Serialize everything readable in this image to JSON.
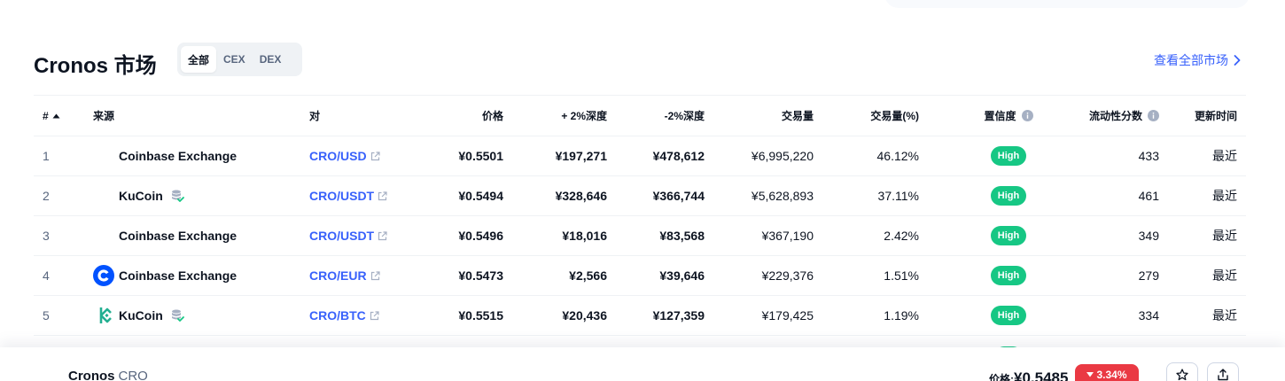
{
  "header": {
    "title": "Cronos 市场",
    "tabs": [
      {
        "label": "全部",
        "active": true
      },
      {
        "label": "CEX",
        "active": false
      },
      {
        "label": "DEX",
        "active": false
      }
    ],
    "view_all": "查看全部市场"
  },
  "table": {
    "columns": {
      "num": "#",
      "source": "来源",
      "pair": "对",
      "price": "价格",
      "depth_plus": "+ 2%深度",
      "depth_minus": "-2%深度",
      "volume": "交易量",
      "volume_pct": "交易量(%)",
      "confidence": "置信度",
      "liquidity": "流动性分数",
      "updated": "更新时间"
    },
    "rows": [
      {
        "num": "1",
        "source": "Coinbase Exchange",
        "logo": "none",
        "db_icon": false,
        "pair": "CRO/USD",
        "price": "¥0.5501",
        "depth_plus": "¥197,271",
        "depth_minus": "¥478,612",
        "volume": "¥6,995,220",
        "volume_pct": "46.12%",
        "confidence": "High",
        "liquidity": "433",
        "updated": "最近"
      },
      {
        "num": "2",
        "source": "KuCoin",
        "logo": "none",
        "db_icon": true,
        "pair": "CRO/USDT",
        "price": "¥0.5494",
        "depth_plus": "¥328,646",
        "depth_minus": "¥366,744",
        "volume": "¥5,628,893",
        "volume_pct": "37.11%",
        "confidence": "High",
        "liquidity": "461",
        "updated": "最近"
      },
      {
        "num": "3",
        "source": "Coinbase Exchange",
        "logo": "none",
        "db_icon": false,
        "pair": "CRO/USDT",
        "price": "¥0.5496",
        "depth_plus": "¥18,016",
        "depth_minus": "¥83,568",
        "volume": "¥367,190",
        "volume_pct": "2.42%",
        "confidence": "High",
        "liquidity": "349",
        "updated": "最近"
      },
      {
        "num": "4",
        "source": "Coinbase Exchange",
        "logo": "coinbase-logo",
        "db_icon": false,
        "pair": "CRO/EUR",
        "price": "¥0.5473",
        "depth_plus": "¥2,566",
        "depth_minus": "¥39,646",
        "volume": "¥229,376",
        "volume_pct": "1.51%",
        "confidence": "High",
        "liquidity": "279",
        "updated": "最近"
      },
      {
        "num": "5",
        "source": "KuCoin",
        "logo": "kucoin-logo",
        "db_icon": true,
        "pair": "CRO/BTC",
        "price": "¥0.5515",
        "depth_plus": "¥20,436",
        "depth_minus": "¥127,359",
        "volume": "¥179,425",
        "volume_pct": "1.19%",
        "confidence": "High",
        "liquidity": "334",
        "updated": "最近"
      }
    ]
  },
  "bottom_bar": {
    "name": "Cronos",
    "symbol": "CRO",
    "price_label": "价格:",
    "price": "¥0.5485",
    "change": "3.34%",
    "change_direction": "down"
  },
  "colors": {
    "accent": "#3861fb",
    "high": "#16c784",
    "down": "#ea3943",
    "text": "#0d1421",
    "muted": "#58667e",
    "coinbase": "#0052ff",
    "kucoin": "#23af91"
  },
  "icons": {
    "sort": "caret-up-icon",
    "info": "info-circle-icon",
    "external": "external-link-icon",
    "database": "database-check-icon",
    "view_all_arrow": "chevron-right-icon",
    "star": "star-icon",
    "share": "share-icon"
  }
}
